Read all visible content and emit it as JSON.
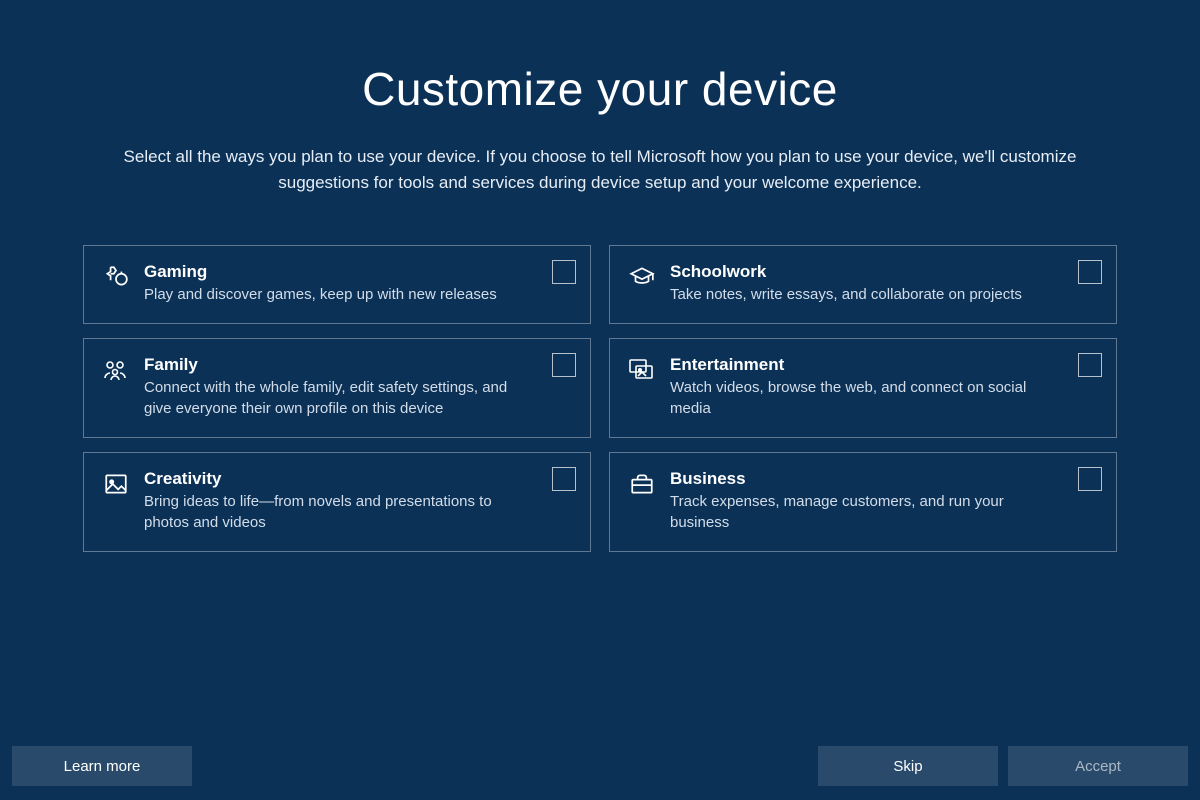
{
  "title": "Customize your device",
  "subtitle": "Select all the ways you plan to use your device. If you choose to tell Microsoft how you plan to use your device, we'll customize suggestions for tools and services during device setup and your welcome experience.",
  "cards": [
    {
      "title": "Gaming",
      "desc": "Play and discover games, keep up with new releases"
    },
    {
      "title": "Schoolwork",
      "desc": "Take notes, write essays, and collaborate on projects"
    },
    {
      "title": "Family",
      "desc": "Connect with the whole family, edit safety settings, and give everyone their own profile on this device"
    },
    {
      "title": "Entertainment",
      "desc": "Watch videos, browse the web, and connect on social media"
    },
    {
      "title": "Creativity",
      "desc": "Bring ideas to life—from novels and presentations to photos and videos"
    },
    {
      "title": "Business",
      "desc": "Track expenses, manage customers, and run your business"
    }
  ],
  "buttons": {
    "learn_more": "Learn more",
    "skip": "Skip",
    "accept": "Accept"
  }
}
